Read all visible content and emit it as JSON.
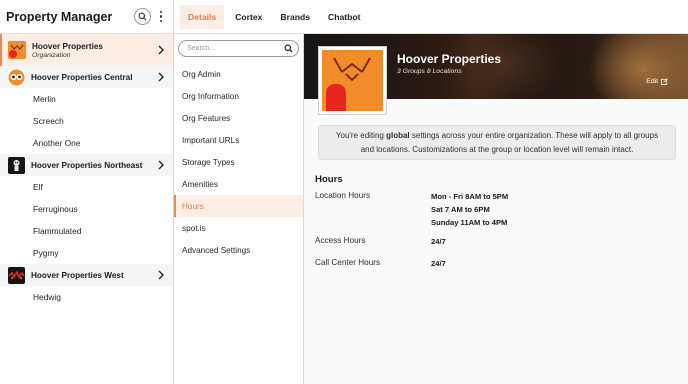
{
  "sidebar": {
    "title": "Property Manager",
    "search_icon": "search-icon",
    "menu_icon": "more-vertical-icon",
    "top_org": {
      "name": "Hoover Properties",
      "subtitle": "Organization"
    },
    "groups": [
      {
        "name": "Hoover Properties Central",
        "children": [
          "Merlin",
          "Screech",
          "Another One"
        ]
      },
      {
        "name": "Hoover Properties Northeast",
        "children": [
          "Elf",
          "Ferruginous",
          "Flammulated",
          "Pygmy"
        ]
      },
      {
        "name": "Hoover Properties West",
        "children": [
          "Hedwig"
        ]
      }
    ]
  },
  "tabs": [
    {
      "label": "Details",
      "active": true
    },
    {
      "label": "Cortex",
      "active": false
    },
    {
      "label": "Brands",
      "active": false
    },
    {
      "label": "Chatbot",
      "active": false
    }
  ],
  "nav": {
    "search_placeholder": "Search...",
    "items": [
      {
        "label": "Org Admin"
      },
      {
        "label": "Org Information"
      },
      {
        "label": "Org Features"
      },
      {
        "label": "Important URLs"
      },
      {
        "label": "Storage Types"
      },
      {
        "label": "Amenities"
      },
      {
        "label": "Hours",
        "active": true
      },
      {
        "label": "spot.is"
      },
      {
        "label": "Advanced Settings"
      }
    ]
  },
  "main": {
    "org_name": "Hoover Properties",
    "org_meta": "3 Groups 8 Locations",
    "edit_label": "Edit",
    "info_prefix": "You're editing ",
    "info_bold": "global",
    "info_line1_rest": " settings across your entire organization. These will apply to all groups",
    "info_line2": "and locations. Customizations at the group or location level will remain intact.",
    "section_title": "Hours",
    "hours": [
      {
        "label": "Location Hours",
        "values": [
          "Mon - Fri 8AM to 5PM",
          "Sat 7 AM to 6PM",
          "Sunday 11AM to 4PM"
        ]
      },
      {
        "label": "Access Hours",
        "values": [
          "24/7"
        ]
      },
      {
        "label": "Call Center Hours",
        "values": [
          "24/7"
        ]
      }
    ]
  },
  "colors": {
    "accent": "#e07a4f",
    "accent_bg": "#fdeee5",
    "owl_orange": "#f28c2b",
    "owl_red": "#e8251f"
  }
}
